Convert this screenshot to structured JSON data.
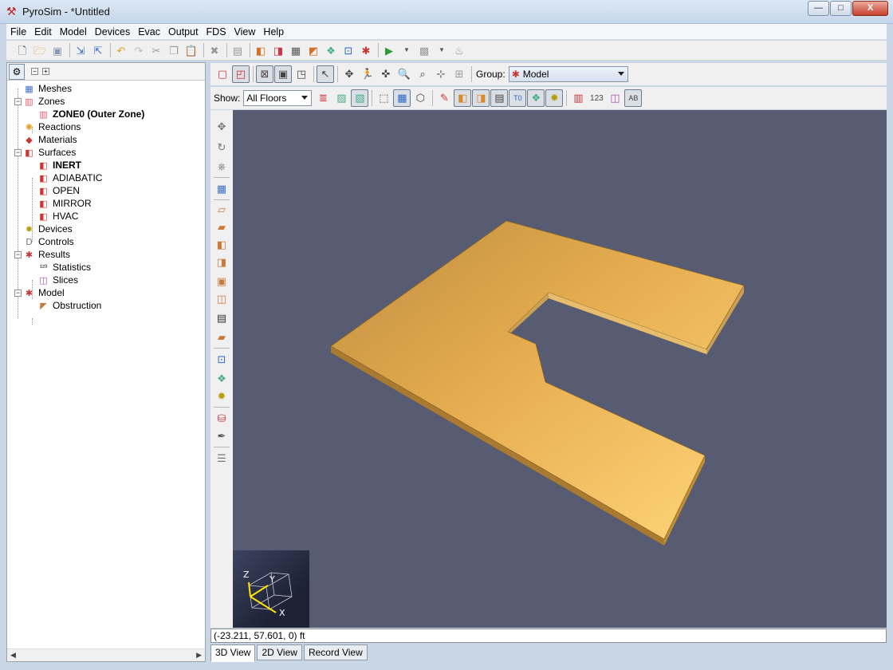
{
  "window": {
    "title": "PyroSim - *Untitled",
    "minimize_glyph": "—",
    "maximize_glyph": "□",
    "close_glyph": "X"
  },
  "menu": [
    "File",
    "Edit",
    "Model",
    "Devices",
    "Evac",
    "Output",
    "FDS",
    "View",
    "Help"
  ],
  "navigation_tree": {
    "items": [
      {
        "label": "Meshes",
        "icon": "mesh-icon",
        "bold": false
      },
      {
        "label": "Zones",
        "icon": "zones-icon",
        "bold": false
      },
      {
        "label": "ZONE0 (Outer Zone)",
        "icon": "zone-icon",
        "bold": true
      },
      {
        "label": "Reactions",
        "icon": "reaction-icon",
        "bold": false
      },
      {
        "label": "Materials",
        "icon": "materials-icon",
        "bold": false
      },
      {
        "label": "Surfaces",
        "icon": "surfaces-icon",
        "bold": false
      },
      {
        "label": "INERT",
        "icon": "surface-icon",
        "bold": true
      },
      {
        "label": "ADIABATIC",
        "icon": "surface-icon",
        "bold": false
      },
      {
        "label": "OPEN",
        "icon": "surface-icon",
        "bold": false
      },
      {
        "label": "MIRROR",
        "icon": "surface-icon",
        "bold": false
      },
      {
        "label": "HVAC",
        "icon": "surface-icon",
        "bold": false
      },
      {
        "label": "Devices",
        "icon": "devices-icon",
        "bold": false
      },
      {
        "label": "Controls",
        "icon": "controls-icon",
        "bold": false
      },
      {
        "label": "Results",
        "icon": "results-icon",
        "bold": false
      },
      {
        "label": "Statistics",
        "icon": "statistics-icon",
        "bold": false
      },
      {
        "label": "Slices",
        "icon": "slices-icon",
        "bold": false
      },
      {
        "label": "Model",
        "icon": "model-icon",
        "bold": false
      },
      {
        "label": "Obstruction",
        "icon": "obstruction-icon",
        "bold": false
      }
    ]
  },
  "view_toolbar": {
    "group_label": "Group:",
    "group_value": "Model",
    "show_label": "Show:",
    "show_value": "All Floors",
    "t0_label": "T0",
    "stats_label": "123",
    "ab_label": "AB"
  },
  "viewport": {
    "axis_x": "X",
    "axis_y": "Y",
    "axis_z": "Z"
  },
  "status": {
    "coordinates": "(-23.211, 57.601, 0) ft"
  },
  "tabs": [
    "3D View",
    "2D View",
    "Record View"
  ],
  "colors": {
    "viewport_bg": "#575c72",
    "slab_top": "#f2b64f",
    "slab_side": "#c98f2e"
  }
}
